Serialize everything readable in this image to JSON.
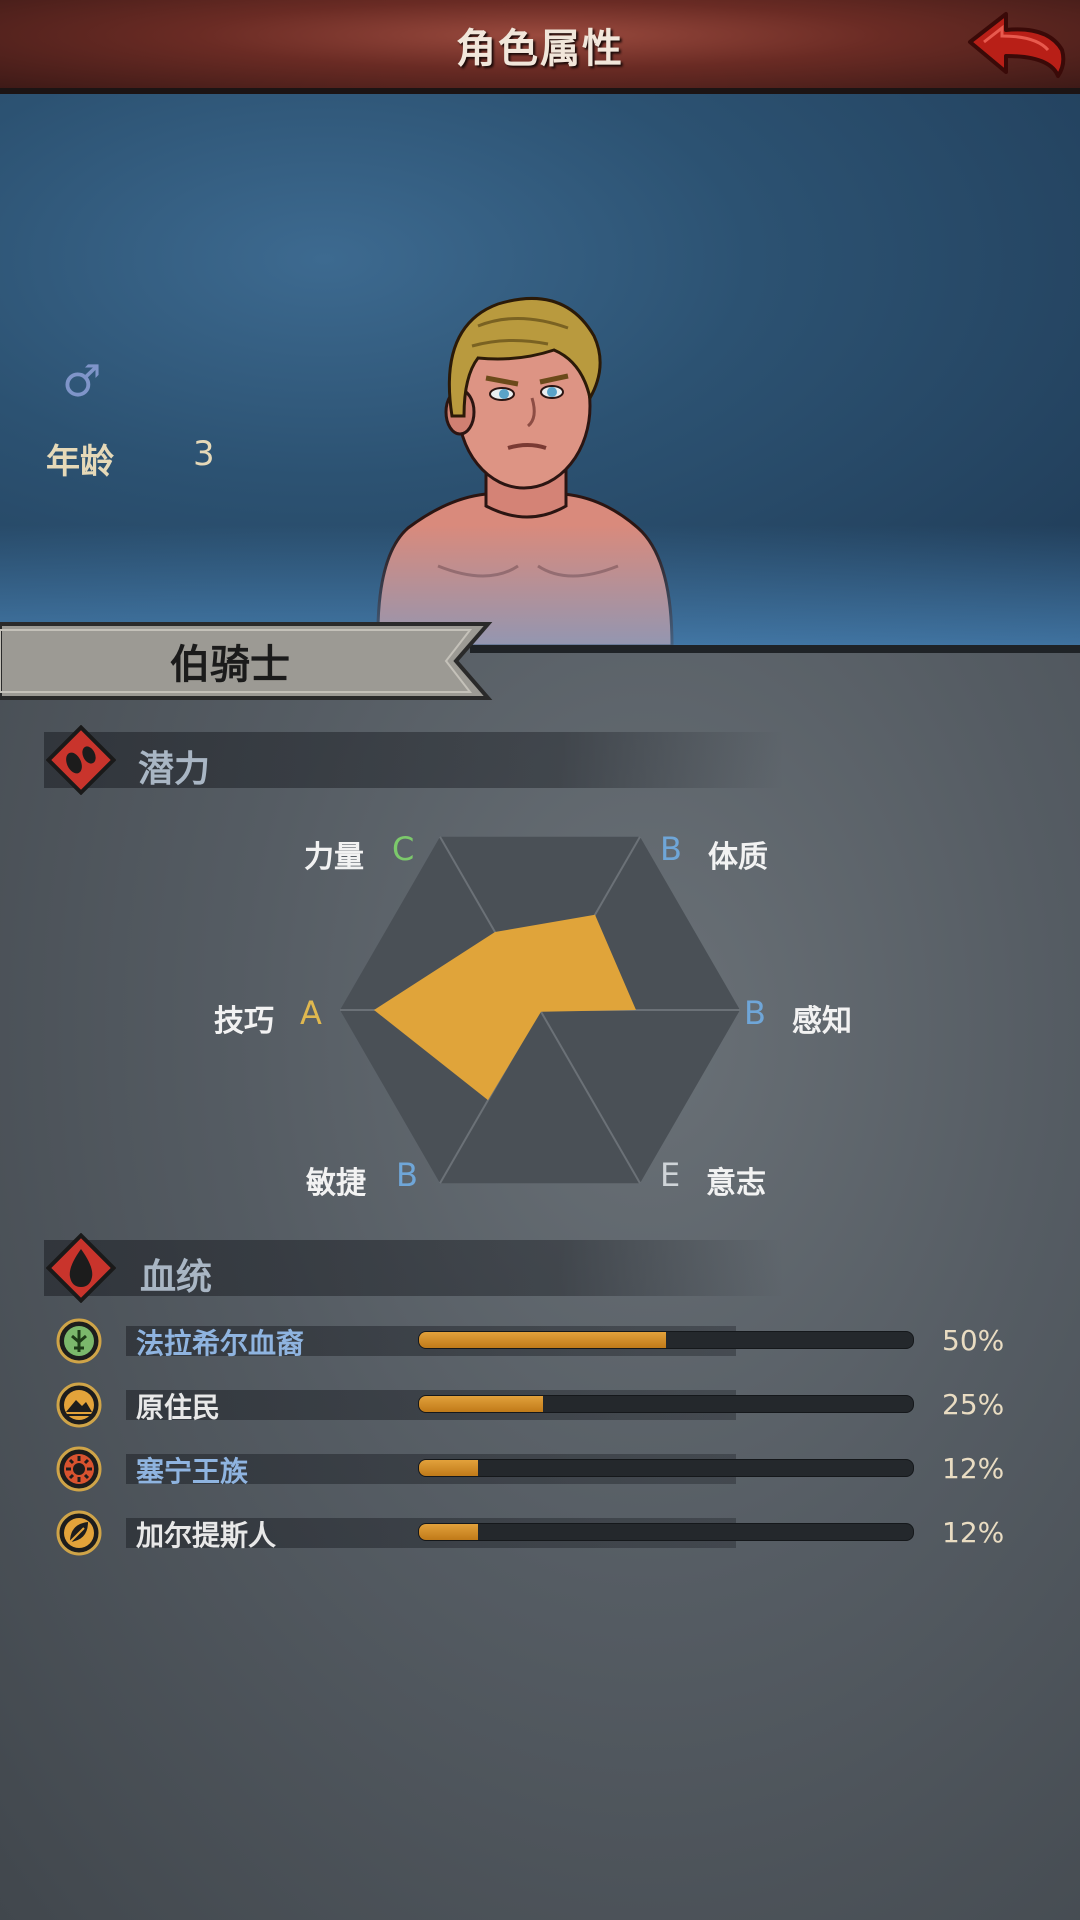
{
  "header": {
    "title": "角色属性"
  },
  "profile": {
    "gender_icon": "male-symbol-icon",
    "age_label": "年龄",
    "age_value": "3",
    "rank": "伯骑士"
  },
  "potential": {
    "title": "潜力",
    "icon": "footprint-icon",
    "stats": [
      {
        "name": "力量",
        "grade": "C",
        "grade_color": "#7cc96b",
        "value": 0.45
      },
      {
        "name": "体质",
        "grade": "B",
        "grade_color": "#6fa6d8",
        "value": 0.55
      },
      {
        "name": "感知",
        "grade": "B",
        "grade_color": "#6fa6d8",
        "value": 0.48
      },
      {
        "name": "意志",
        "grade": "E",
        "grade_color": "#cfd4d8",
        "value": 0.0
      },
      {
        "name": "敏捷",
        "grade": "B",
        "grade_color": "#6fa6d8",
        "value": 0.52
      },
      {
        "name": "技巧",
        "grade": "A",
        "grade_color": "#e0b84f",
        "value": 0.83
      }
    ]
  },
  "bloodline": {
    "title": "血统",
    "icon": "blood-drop-icon",
    "items": [
      {
        "name": "法拉希尔血裔",
        "percent": "50%",
        "value": 0.5,
        "name_color": "#8fb4e0",
        "icon": "tree-emblem-icon",
        "icon_color": "#7bb86c"
      },
      {
        "name": "原住民",
        "percent": "25%",
        "value": 0.25,
        "name_color": "#e8e8e8",
        "icon": "mountain-emblem-icon",
        "icon_color": "#e3a33a"
      },
      {
        "name": "塞宁王族",
        "percent": "12%",
        "value": 0.12,
        "name_color": "#8fb4e0",
        "icon": "sun-emblem-icon",
        "icon_color": "#d9532f"
      },
      {
        "name": "加尔提斯人",
        "percent": "12%",
        "value": 0.12,
        "name_color": "#e8e8e8",
        "icon": "leaf-emblem-icon",
        "icon_color": "#e3a33a"
      }
    ]
  },
  "colors": {
    "accent": "#e0a43a",
    "header": "#6a2b24",
    "panel": "#555c63"
  }
}
